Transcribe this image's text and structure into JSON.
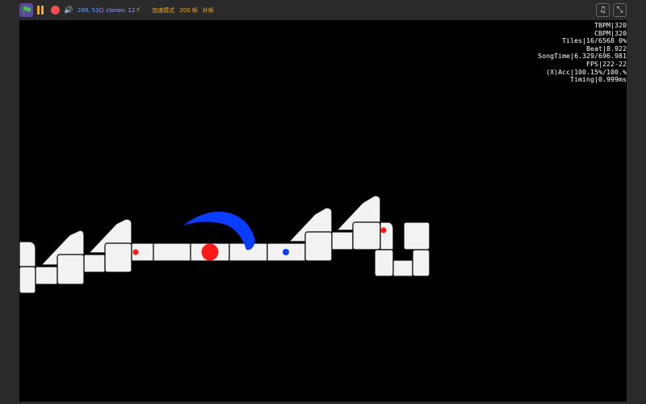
{
  "toolbar": {
    "icons": [
      "green-flag-icon",
      "pause-icon",
      "stop-icon",
      "volume-icon",
      "clones-icon",
      "lightning-icon",
      "sound-settings-icon",
      "fullscreen-exit-icon"
    ],
    "coords": "288, 51",
    "clones": "clones: 12",
    "turbo_label": "加速模式",
    "fps_label": "200 帧",
    "interp_label": "补帧"
  },
  "hud": [
    {
      "label": "TBPM",
      "value": "320"
    },
    {
      "label": "CBPM",
      "value": "320"
    },
    {
      "label": "Tiles",
      "value": "16/6568 0%"
    },
    {
      "label": "Beat",
      "value": "8.922"
    },
    {
      "label": "SongTime",
      "value": "6.329/696.981"
    },
    {
      "label": "FPS",
      "value": "222-22"
    },
    {
      "label": "(X)Acc",
      "value": "100.15%/100.%"
    },
    {
      "label": "Timing",
      "value": "0.999ms"
    }
  ],
  "colors": {
    "fire": "#ff1a1a",
    "ice": "#0a3dff",
    "tile": "#f2f2f2",
    "accent_orange": "#f5a623",
    "accent_blue": "#5da6ff"
  }
}
